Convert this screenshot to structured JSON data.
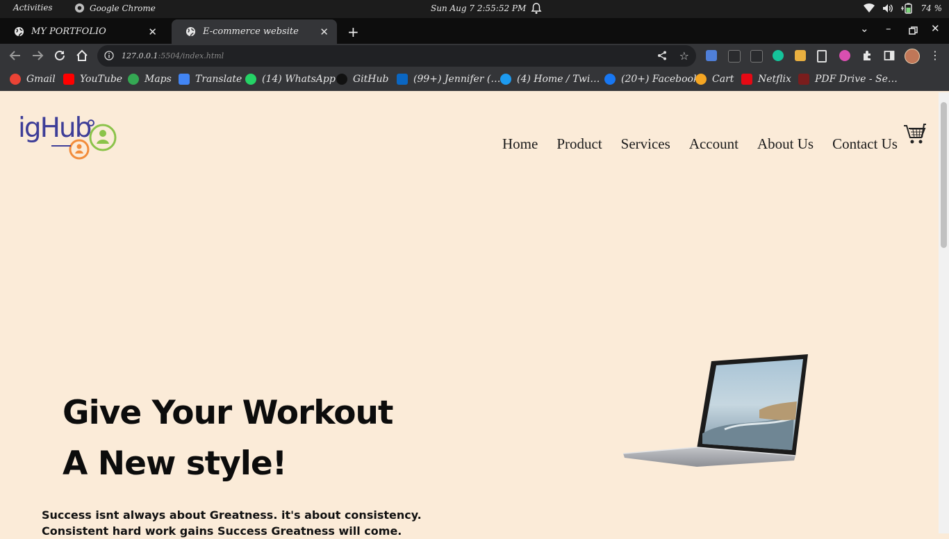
{
  "os": {
    "activities": "Activities",
    "app_name": "Google Chrome",
    "datetime": "Sun Aug 7   2:55:52 PM",
    "battery": "74 %"
  },
  "tabs": [
    {
      "title": "MY PORTFOLIO",
      "active": false
    },
    {
      "title": "E-commerce website",
      "active": true
    }
  ],
  "omnibox": {
    "host": "127.0.0.1",
    "path": ":5504/index.html"
  },
  "bookmarks": [
    {
      "label": "Gmail",
      "icon": "gmail-icon",
      "color": "#ea4335"
    },
    {
      "label": "YouTube",
      "icon": "youtube-icon",
      "color": "#ff0000"
    },
    {
      "label": "Maps",
      "icon": "maps-icon",
      "color": "#34a853"
    },
    {
      "label": "Translate",
      "icon": "translate-icon",
      "color": "#4285f4"
    },
    {
      "label": "(14) WhatsApp",
      "icon": "whatsapp-icon",
      "color": "#25d366"
    },
    {
      "label": "GitHub",
      "icon": "github-icon",
      "color": "#111111"
    },
    {
      "label": "(99+) Jennifer (…",
      "icon": "linkedin-icon",
      "color": "#0a66c2"
    },
    {
      "label": "(4) Home / Twi…",
      "icon": "twitter-icon",
      "color": "#1d9bf0"
    },
    {
      "label": "(20+) Facebook",
      "icon": "facebook-icon",
      "color": "#1877f2"
    },
    {
      "label": "Cart",
      "icon": "cart-star-icon",
      "color": "#f5a623"
    },
    {
      "label": "Netflix",
      "icon": "netflix-icon",
      "color": "#e50914"
    },
    {
      "label": "PDF Drive - Se…",
      "icon": "pdfdrive-icon",
      "color": "#7a1d1d"
    }
  ],
  "site": {
    "logo_text": "igHub",
    "nav": [
      "Home",
      "Product",
      "Services",
      "Account",
      "About Us",
      "Contact Us"
    ],
    "hero_line1": "Give Your Workout",
    "hero_line2": "A New style!",
    "hero_text": "Success isnt always about Greatness. it's about consistency. Consistent hard work gains Success Greatness will come."
  },
  "colors": {
    "page_bg": "#fbebd8",
    "logo_blue": "#3e3e98",
    "logo_green": "#8bc34a",
    "logo_orange": "#f28c3a"
  }
}
